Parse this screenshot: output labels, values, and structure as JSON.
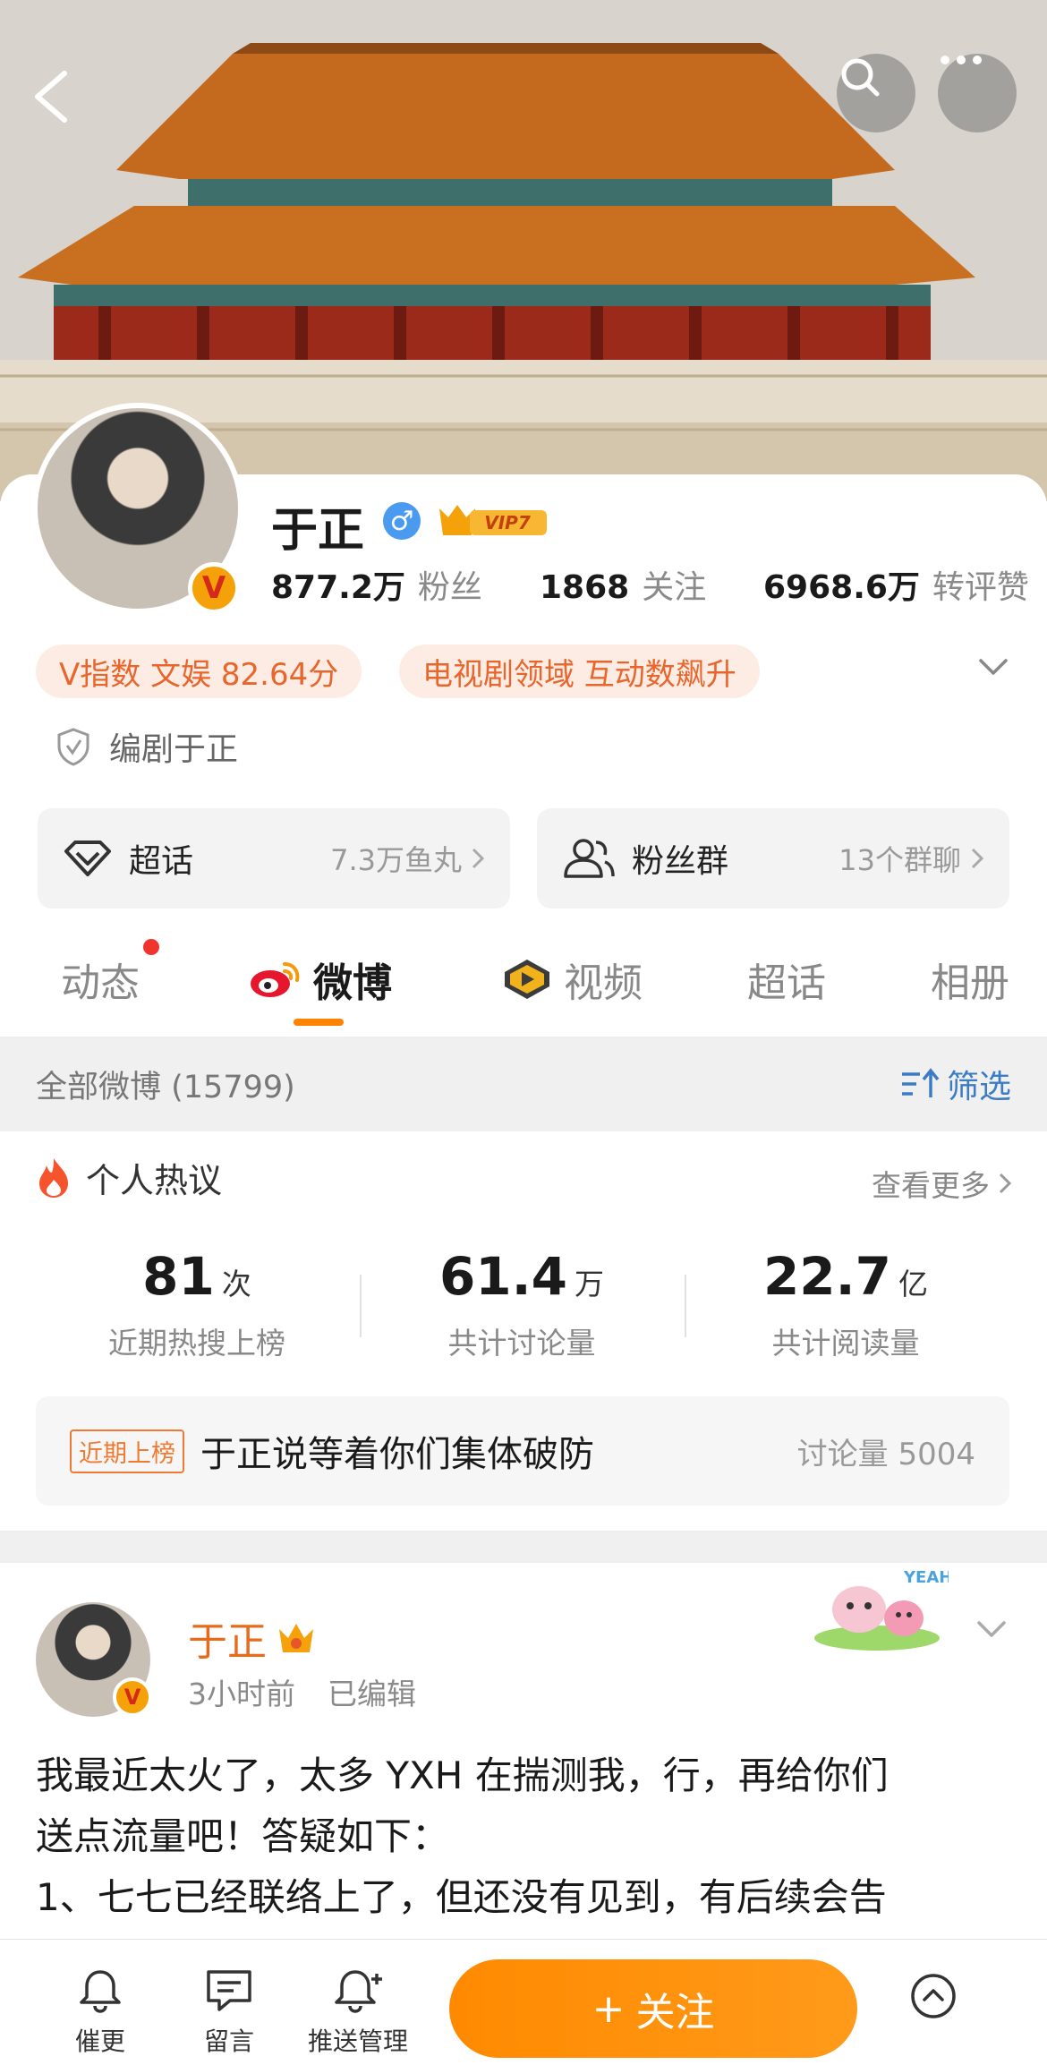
{
  "header": {
    "back": "back",
    "search": "search",
    "more": "more"
  },
  "profile": {
    "name": "于正",
    "gender": "♂",
    "vip_label": "VIP7",
    "stats": [
      {
        "value": "877.2万",
        "label": "粉丝"
      },
      {
        "value": "1868",
        "label": "关注"
      },
      {
        "value": "6968.6万",
        "label": "转评赞"
      }
    ],
    "tags": [
      "V指数 文娱 82.64分",
      "电视剧领域 互动数飙升"
    ],
    "certification": "编剧于正"
  },
  "actions": {
    "chaohua": {
      "label": "超话",
      "meta": "7.3万鱼丸"
    },
    "fans_group": {
      "label": "粉丝群",
      "meta": "13个群聊"
    }
  },
  "tabs": [
    "动态",
    "微博",
    "视频",
    "超话",
    "相册"
  ],
  "filter_bar": {
    "all": "全部微博 (15799)",
    "filter": "筛选"
  },
  "hot": {
    "title": "个人热议",
    "more": "查看更多",
    "metrics": [
      {
        "num": "81",
        "unit": "次",
        "desc": "近期热搜上榜"
      },
      {
        "num": "61.4",
        "unit": "万",
        "desc": "共计讨论量"
      },
      {
        "num": "22.7",
        "unit": "亿",
        "desc": "共计阅读量"
      }
    ],
    "row": {
      "badge": "近期上榜",
      "text": "于正说等着你们集体破防",
      "count": "讨论量 5004"
    }
  },
  "post": {
    "name": "于正",
    "time": "3小时前",
    "edited": "已编辑",
    "sticker_text": "YEAH!",
    "lines": [
      "我最近太火了，太多 YXH 在揣测我，行，再给你们",
      "送点流量吧！答疑如下：",
      "1、七七已经联络上了，但还没有见到，有后续会告"
    ]
  },
  "bottom_bar": {
    "items": [
      "催更",
      "留言",
      "推送管理"
    ],
    "follow": "关注"
  },
  "colors": {
    "accent": "#ff8200",
    "tag_bg": "#fdece3",
    "tag_text": "#e8652b",
    "link": "#3b7cc4"
  }
}
